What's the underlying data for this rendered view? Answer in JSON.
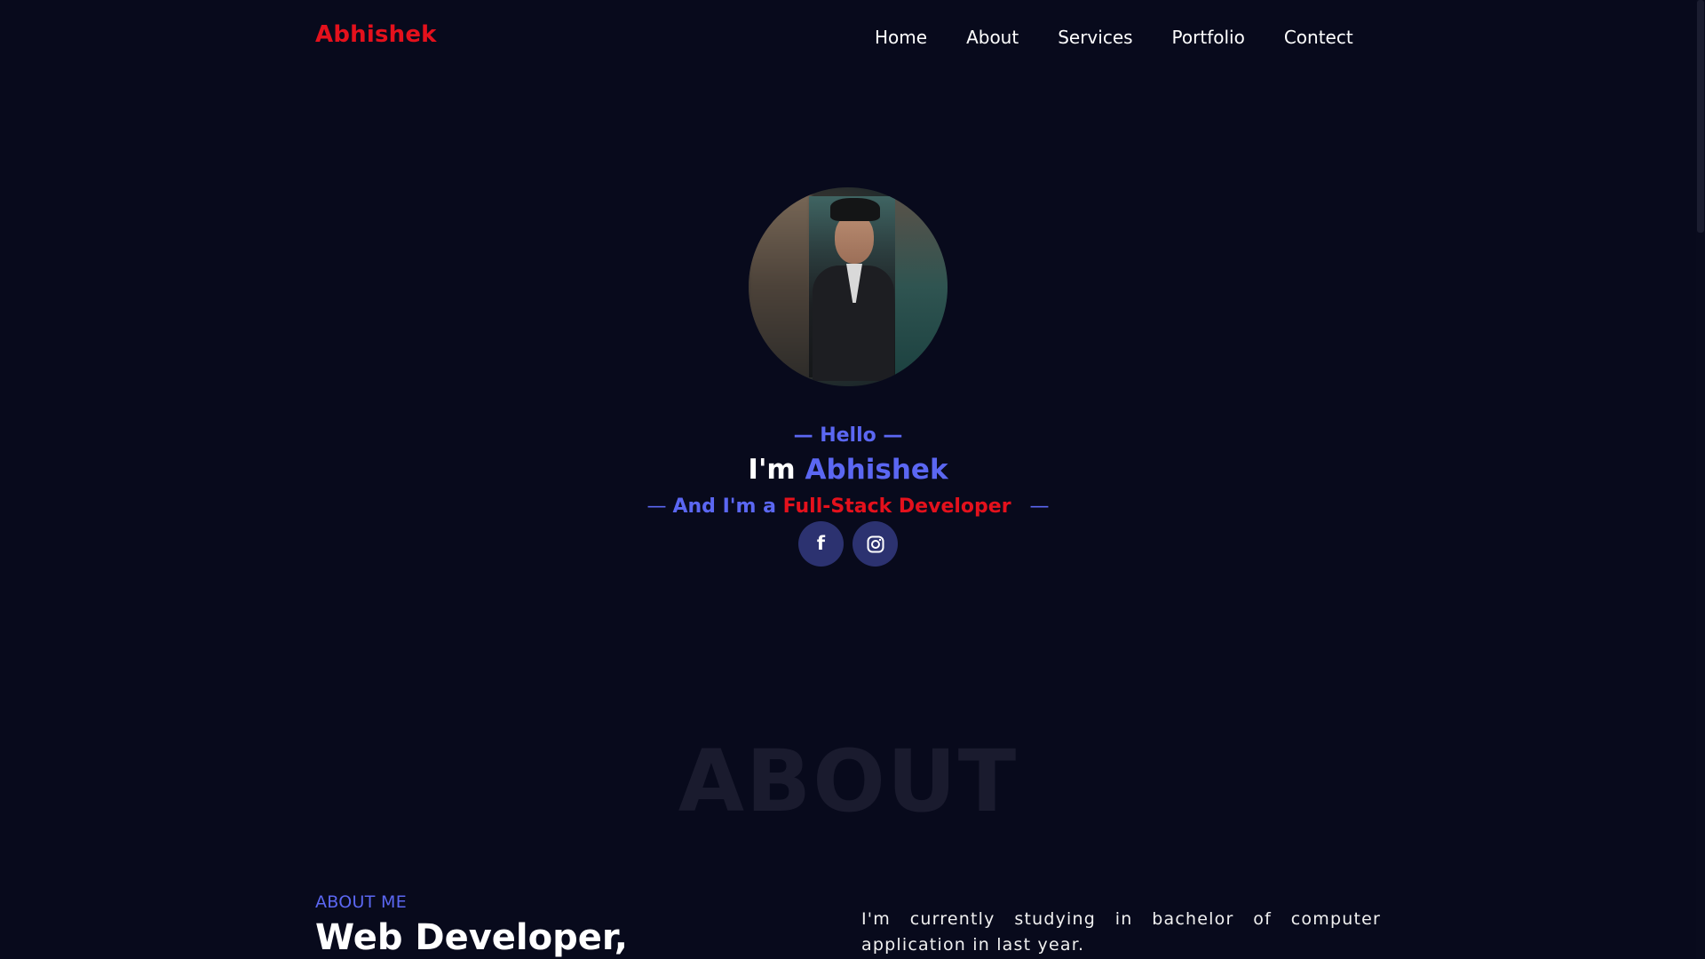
{
  "colors": {
    "background": "#080a1c",
    "accent_blue": "#5b67f2",
    "accent_red": "#e4111c",
    "social_button_bg": "#2c3270",
    "watermark": "#1a1b2e"
  },
  "navbar": {
    "logo": "Abhishek",
    "links": [
      "Home",
      "About",
      "Services",
      "Portfolio",
      "Contect"
    ]
  },
  "hero": {
    "avatar_icon": "profile-photo",
    "hello": "— Hello —",
    "im_prefix": "I'm ",
    "name": "Abhishek",
    "role_dash_left": "— ",
    "role_prefix": "And I'm a ",
    "role_title": "Full-Stack Developer",
    "role_dash_right": "   —",
    "social": [
      {
        "icon": "facebook-icon"
      },
      {
        "icon": "instagram-icon"
      }
    ]
  },
  "about": {
    "watermark": "ABOUT",
    "label": "ABOUT ME",
    "heading": "Web Developer,",
    "text": "I'm currently studying in bachelor of computer application in last year."
  }
}
